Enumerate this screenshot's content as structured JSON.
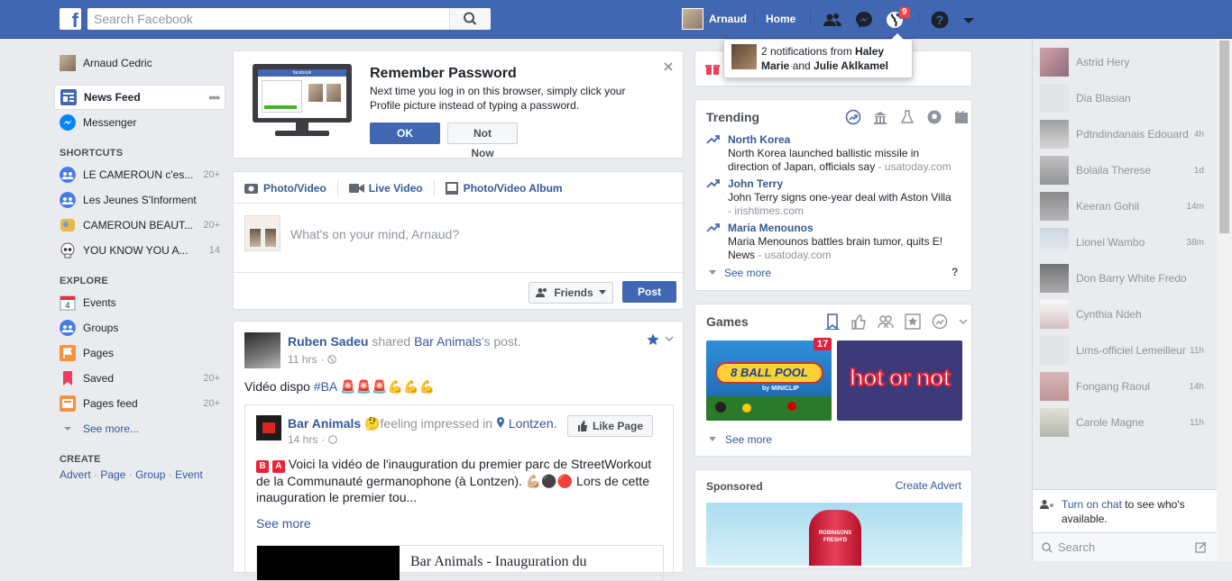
{
  "topbar": {
    "logo": "f",
    "search_placeholder": "Search Facebook",
    "user_name": "Arnaud",
    "home": "Home",
    "notif_count": "9"
  },
  "flyout": {
    "text": "2 notifications from Haley Marie and Julie Aklkamel",
    "pre": "2 notifications from ",
    "name1": "Haley Marie",
    "mid": " and ",
    "name2": "Julie Aklkamel"
  },
  "left": {
    "profile": "Arnaud Cedric",
    "news_feed": "News Feed",
    "more": "•••",
    "messenger": "Messenger",
    "shortcuts_title": "SHORTCUTS",
    "shortcuts": [
      {
        "label": "LE CAMEROUN c'es...",
        "count": "20+"
      },
      {
        "label": "Les Jeunes S'Informent",
        "count": ""
      },
      {
        "label": "CAMEROUN BEAUT...",
        "count": "20+"
      },
      {
        "label": "YOU KNOW YOU A...",
        "count": "14"
      }
    ],
    "explore_title": "EXPLORE",
    "explore": [
      {
        "label": "Events",
        "count": ""
      },
      {
        "label": "Groups",
        "count": ""
      },
      {
        "label": "Pages",
        "count": ""
      },
      {
        "label": "Saved",
        "count": "20+"
      },
      {
        "label": "Pages feed",
        "count": "20+"
      }
    ],
    "see_more": "See more...",
    "events_day": "4",
    "create_title": "CREATE",
    "create_links": [
      "Advert",
      "Page",
      "Group",
      "Event"
    ]
  },
  "remember": {
    "title": "Remember Password",
    "body": "Next time you log in on this browser, simply click your Profile picture instead of typing a password.",
    "ok": "OK",
    "not_now": "Not Now",
    "thumb_logo": "facebook"
  },
  "composer": {
    "tabs": [
      "Photo/Video",
      "Live Video",
      "Photo/Video Album"
    ],
    "placeholder": "What's on your mind, Arnaud?",
    "audience": "Friends",
    "post": "Post"
  },
  "post": {
    "author": "Ruben Sadeu",
    "action": " shared ",
    "page": "Bar Animals",
    "suffix": "'s post.",
    "time": "11 hrs",
    "text": "Vidéo dispo ",
    "hashtag": "#BA",
    "emoji": "🚨🚨🚨💪💪💪",
    "inner": {
      "author": "Bar Animals",
      "feeling": "feeling impressed in",
      "place": "Lontzen.",
      "time": "14 hrs",
      "like_page": "Like Page",
      "line1": "Voici la vidéo de l'inauguration du premier parc de StreetWorkout",
      "line2": "de la Communauté germanophone (à Lontzen). 💪🏼⚫🔴 Lors de cette",
      "line3": "inauguration le premier tou...",
      "see_more": "See more",
      "preview_title": "Bar Animals - Inauguration du"
    }
  },
  "trending": {
    "title": "Trending",
    "items": [
      {
        "name": "North Korea",
        "desc": "North Korea launched ballistic missile in direction of Japan, officials say",
        "source": "usatoday.com"
      },
      {
        "name": "John Terry",
        "desc": "John Terry signs one-year deal with Aston Villa",
        "source": "irishtimes.com"
      },
      {
        "name": "Maria Menounos",
        "desc": "Maria Menounos battles brain tumor, quits E! News",
        "source": "usatoday.com"
      }
    ],
    "see_more": "See more",
    "help": "?"
  },
  "games": {
    "title": "Games",
    "badge": "17",
    "game1": "8 BALL POOL",
    "game1_brand": "by MINICLIP",
    "game2": "hot or not",
    "see_more": "See more"
  },
  "sponsored": {
    "title": "Sponsored",
    "create": "Create Advert",
    "ad_text": "ROBINSONS FRESH'D"
  },
  "chat": {
    "contacts": [
      {
        "name": "Astrid Hery",
        "time": ""
      },
      {
        "name": "Dia Blasian",
        "time": ""
      },
      {
        "name": "Pdtndindanais Edouard",
        "time": "4h"
      },
      {
        "name": "Bolaila Therese",
        "time": "1d"
      },
      {
        "name": "Keeran Gohil",
        "time": "14m"
      },
      {
        "name": "Lionel Wambo",
        "time": "38m"
      },
      {
        "name": "Don Barry White Fredo",
        "time": ""
      },
      {
        "name": "Cynthia Ndeh",
        "time": ""
      },
      {
        "name": "Lims-officiel Lemeilleur",
        "time": "11h"
      },
      {
        "name": "Fongang Raoul",
        "time": "14h"
      },
      {
        "name": "Carole Magne",
        "time": "11h"
      }
    ],
    "turn_on": "Turn on chat",
    "turn_on_rest": " to see who's available.",
    "search": "Search"
  }
}
